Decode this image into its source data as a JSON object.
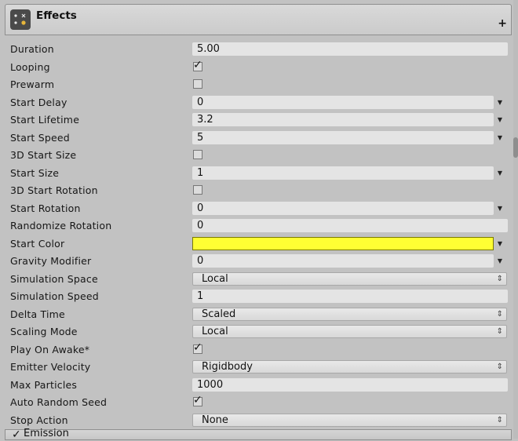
{
  "module": {
    "title": "Effects",
    "icon": "particle-system-icon",
    "add_icon": "+"
  },
  "colors": {
    "start_color": "#ffff33",
    "panel_bg": "#c2c2c2",
    "field_bg": "#e4e4e4"
  },
  "properties": [
    {
      "label": "Duration",
      "type": "value",
      "value": "5.00",
      "dropdown": false
    },
    {
      "label": "Looping",
      "type": "checkbox",
      "checked": true
    },
    {
      "label": "Prewarm",
      "type": "checkbox",
      "checked": false
    },
    {
      "label": "Start Delay",
      "type": "value",
      "value": "0",
      "dropdown": true
    },
    {
      "label": "Start Lifetime",
      "type": "value",
      "value": "3.2",
      "dropdown": true
    },
    {
      "label": "Start Speed",
      "type": "value",
      "value": "5",
      "dropdown": true
    },
    {
      "label": "3D Start Size",
      "type": "checkbox",
      "checked": false
    },
    {
      "label": "Start Size",
      "type": "value",
      "value": "1",
      "dropdown": true
    },
    {
      "label": "3D Start Rotation",
      "type": "checkbox",
      "checked": false
    },
    {
      "label": "Start Rotation",
      "type": "value",
      "value": "0",
      "dropdown": true
    },
    {
      "label": "Randomize Rotation",
      "type": "value",
      "value": "0",
      "dropdown": false
    },
    {
      "label": "Start Color",
      "type": "color",
      "value": "#ffff33",
      "dropdown": true
    },
    {
      "label": "Gravity Modifier",
      "type": "value",
      "value": "0",
      "dropdown": true
    },
    {
      "label": "Simulation Space",
      "type": "popup",
      "value": "Local"
    },
    {
      "label": "Simulation Speed",
      "type": "value",
      "value": "1",
      "dropdown": false
    },
    {
      "label": "Delta Time",
      "type": "popup",
      "value": "Scaled"
    },
    {
      "label": "Scaling Mode",
      "type": "popup",
      "value": "Local"
    },
    {
      "label": "Play On Awake*",
      "type": "checkbox",
      "checked": true
    },
    {
      "label": "Emitter Velocity",
      "type": "popup",
      "value": "Rigidbody"
    },
    {
      "label": "Max Particles",
      "type": "value",
      "value": "1000",
      "dropdown": false
    },
    {
      "label": "Auto Random Seed",
      "type": "checkbox",
      "checked": true
    },
    {
      "label": "Stop Action",
      "type": "popup",
      "value": "None"
    }
  ],
  "next_module": {
    "label": "Emission",
    "enabled": true
  }
}
